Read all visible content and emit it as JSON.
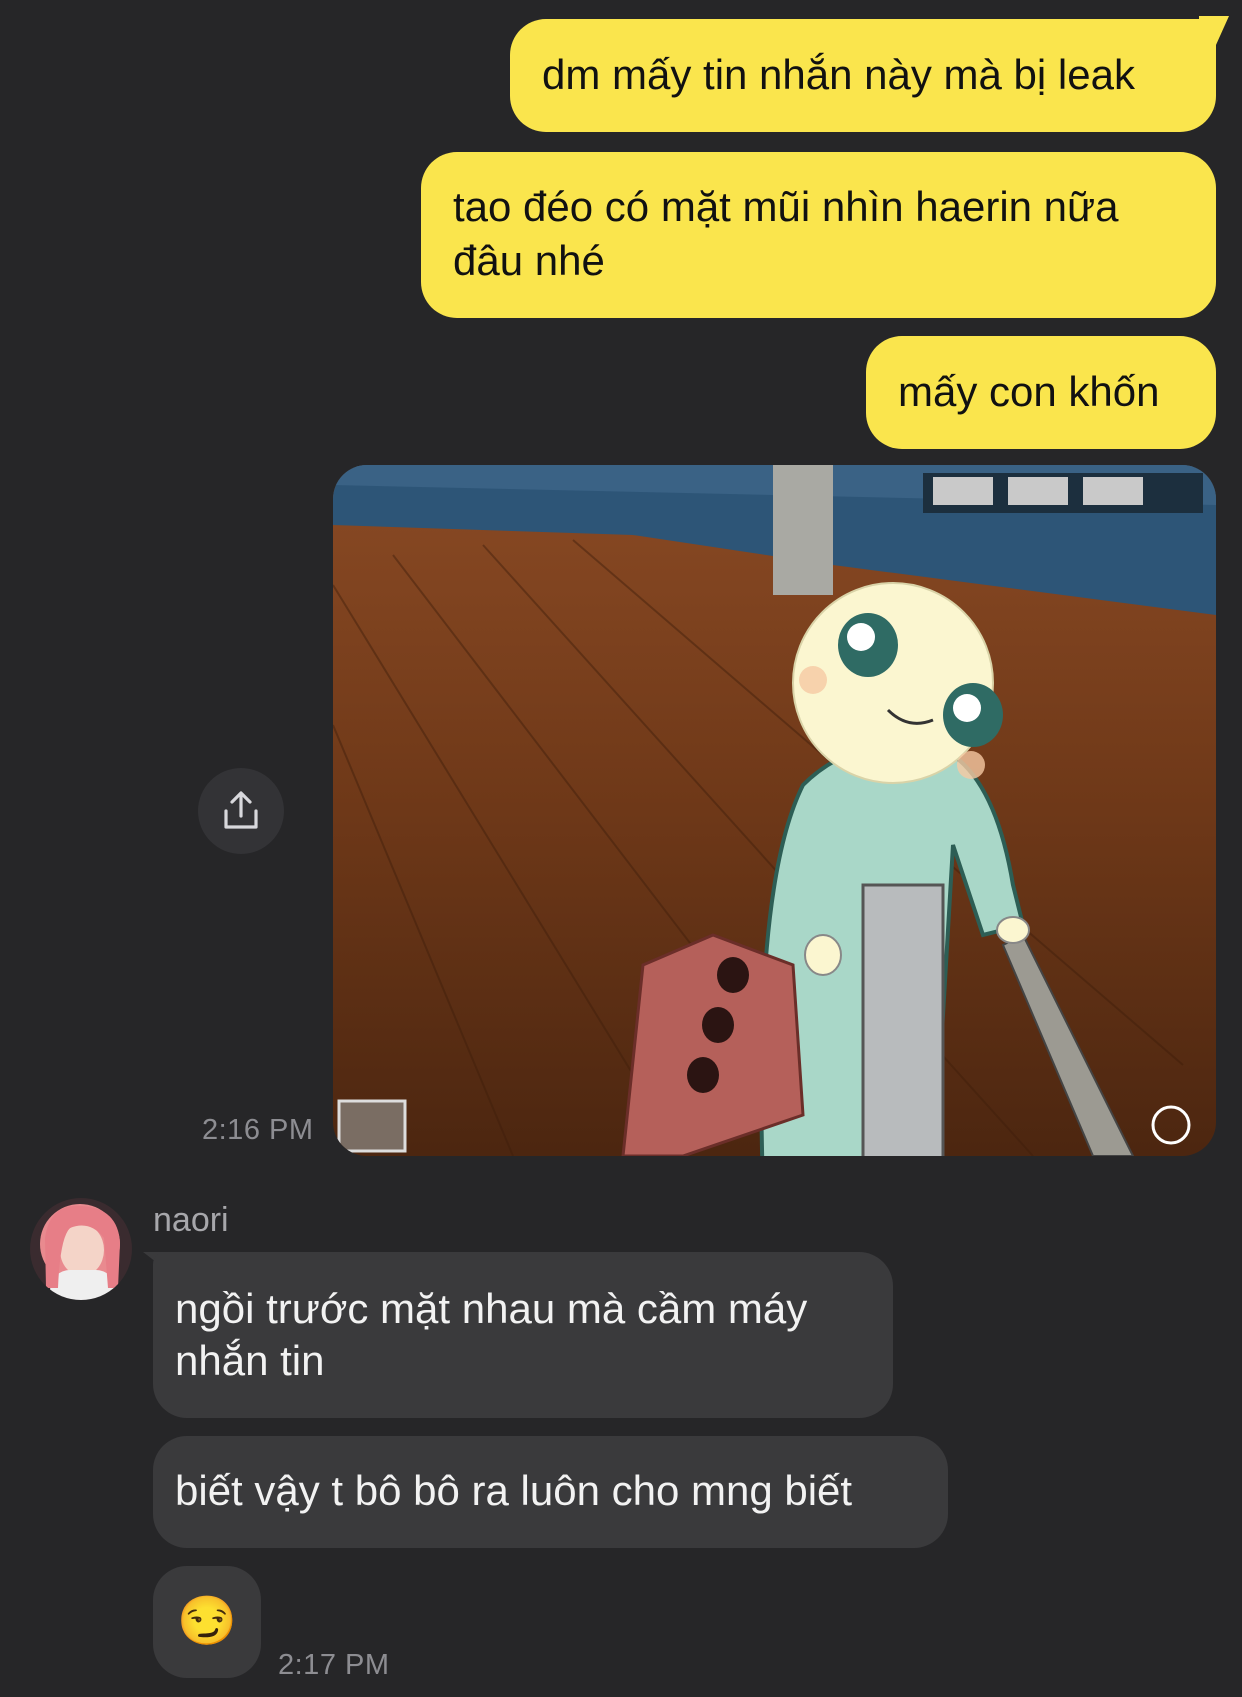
{
  "outgoing": {
    "messages": [
      "dm mấy tin nhắn này mà bị leak",
      "tao đéo có mặt mũi nhìn haerin nữa đâu nhé",
      "mấy con khốn"
    ],
    "time": "2:16 PM"
  },
  "incoming": {
    "sender": "naori",
    "messages": [
      "ngồi trước mặt nhau mà cầm máy nhắn tin",
      "biết vậy t bô bô ra luôn cho mng biết"
    ],
    "emoji": "😏",
    "time": "2:17 PM"
  },
  "colors": {
    "background": "#262628",
    "outgoing_bubble": "#FAE54D",
    "incoming_bubble": "#3a3a3c"
  },
  "icons": {
    "share": "share-icon"
  }
}
